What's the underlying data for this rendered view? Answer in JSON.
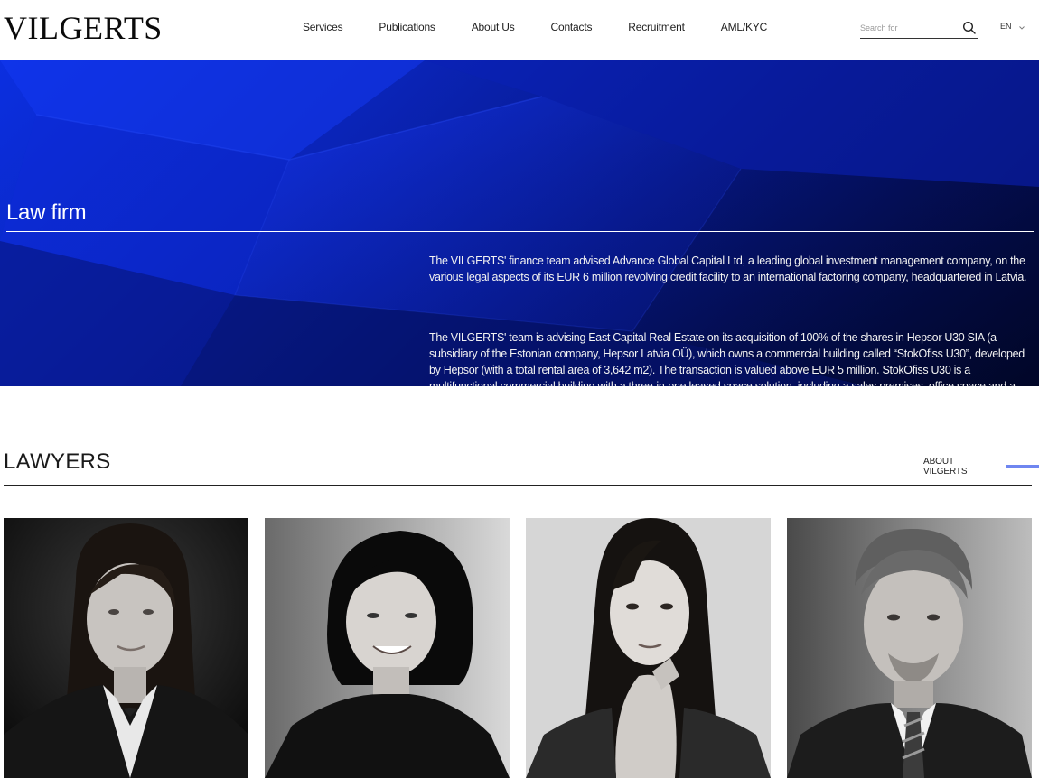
{
  "header": {
    "logo": "VILGERTS",
    "nav": [
      "Services",
      "Publications",
      "About Us",
      "Contacts",
      "Recruitment",
      "AML/KYC"
    ],
    "search_placeholder": "Search for",
    "language": "EN"
  },
  "hero": {
    "title": "Law firm",
    "news": [
      "The VILGERTS' finance team advised Advance Global Capital Ltd, a leading global investment management company, on the various legal aspects of its EUR 6 million revolving credit facility to an international factoring company, headquartered in Latvia.",
      "The VILGERTS' team is advising East Capital Real Estate on its acquisition of 100% of the shares in Hepsor U30 SIA (a subsidiary of the Estonian company, Hepsor Latvia OÜ), which owns a commercial building called “StokOfiss U30”, developed by Hepsor (with a total rental area of 3,642 m2). The transaction is valued above EUR 5 million. StokOfiss U30 is a multifunctional commercial building with a three-in-one leased space solution, including a sales premises, office space and a warehouse."
    ]
  },
  "lawyers": {
    "title": "LAWYERS",
    "about_link": "ABOUT VILGERTS",
    "accent_color": "#6f86f0",
    "portraits": [
      "lawyer-portrait-1",
      "lawyer-portrait-2",
      "lawyer-portrait-3",
      "lawyer-portrait-4"
    ]
  },
  "colors": {
    "hero_blue": "#0b2fe0",
    "hero_dark": "#030a45"
  }
}
